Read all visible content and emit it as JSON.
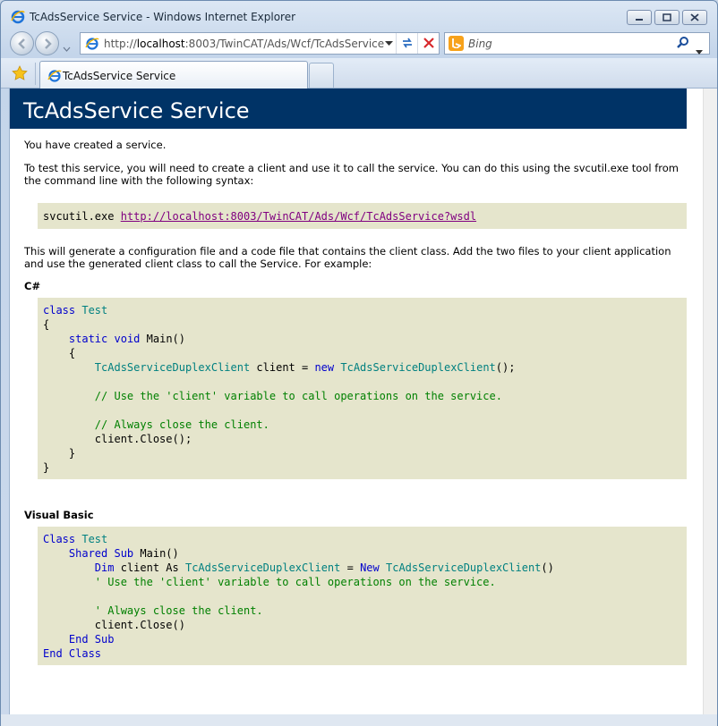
{
  "window": {
    "title": "TcAdsService Service - Windows Internet Explorer"
  },
  "address": {
    "url_prefix": "http://",
    "url_host": "localhost",
    "url_rest": ":8003/TwinCAT/Ads/Wcf/TcAdsService"
  },
  "search": {
    "placeholder": "Bing"
  },
  "tabs": [
    {
      "label": "TcAdsService Service"
    }
  ],
  "page": {
    "heading": "TcAdsService Service",
    "intro": "You have created a service.",
    "instructions": "To test this service, you will need to create a client and use it to call the service. You can do this using the svcutil.exe tool from the command line with the following syntax:",
    "svcutil_cmd": "svcutil.exe",
    "wsdl_link": "http://localhost:8003/TwinCAT/Ads/Wcf/TcAdsService?wsdl",
    "generate_text": "This will generate a configuration file and a code file that contains the client class. Add the two files to your client application and use the generated client class to call the Service. For example:",
    "csharp_label": "C#",
    "vb_label": "Visual Basic"
  },
  "csharp_code": {
    "kw_class": "class",
    "name_test": "Test",
    "open_brace": "{",
    "close_brace": "}",
    "kw_static": "static",
    "kw_void": "void",
    "main_call": "Main()",
    "client_type": "TcAdsServiceDuplexClient",
    "client_var": "client =",
    "kw_new": "new",
    "new_tail": "();",
    "comment_use": "// Use the 'client' variable to call operations on the service.",
    "comment_close": "// Always close the client.",
    "close_call": "client.Close();"
  },
  "vb_code": {
    "kw_class": "Class",
    "name_test": "Test",
    "kw_shared_sub": "Shared Sub",
    "main_call": "Main()",
    "kw_dim": "Dim",
    "client_as": "client As",
    "client_type": "TcAdsServiceDuplexClient",
    "equals": "=",
    "kw_new": "New",
    "new_tail": "()",
    "comment_use": "' Use the 'client' variable to call operations on the service.",
    "comment_close": "' Always close the client.",
    "close_call": "client.Close()",
    "kw_end_sub": "End Sub",
    "kw_end_class": "End Class"
  },
  "colors": {
    "heading_bg": "#003366",
    "code_bg": "#e5e5cc",
    "keyword": "#0000cc",
    "type": "#008080",
    "comment": "#008000",
    "link": "#800080"
  }
}
